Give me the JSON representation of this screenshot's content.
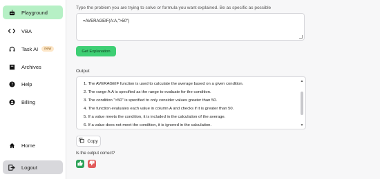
{
  "sidebar": {
    "items": [
      {
        "label": "Playground",
        "icon": "robot-icon"
      },
      {
        "label": "VBA",
        "icon": "code-icon"
      },
      {
        "label": "Task AI",
        "icon": "headset-icon",
        "badge": "new"
      },
      {
        "label": "Archives",
        "icon": "archive-icon"
      },
      {
        "label": "Help",
        "icon": "help-icon"
      },
      {
        "label": "Billing",
        "icon": "user-icon"
      }
    ],
    "home_label": "Home",
    "logout_label": "Logout"
  },
  "main": {
    "hint": "Type the problem you are trying to solve or formula you want explained. Be as specific as possible",
    "prompt_value": "=AVERAGEIF(A:A,\">50\")",
    "get_button": "Get Explanation",
    "output_label": "Output",
    "output_lines": [
      "1. The AVERAGEIF function is used to calculate the average based on a given condition.",
      "2. The range A:A is specified as the range to evaluate for the condition.",
      "3. The condition \">50\" is specified to only consider values greater than 50.",
      "4. The function evaluates each value in column A and checks if it is greater than 50.",
      "5. If a value meets the condition, it is included in the calculation of the average.",
      "6. If a value does not meet the condition, it is ignored in the calculation."
    ],
    "copy_label": "Copy",
    "correct_label": "Is the output correct?"
  },
  "colors": {
    "active_nav": "#b6f0c5",
    "primary_button": "#3ecf74",
    "thumb_up": "#2fa35a",
    "thumb_down": "#e25c5c"
  }
}
